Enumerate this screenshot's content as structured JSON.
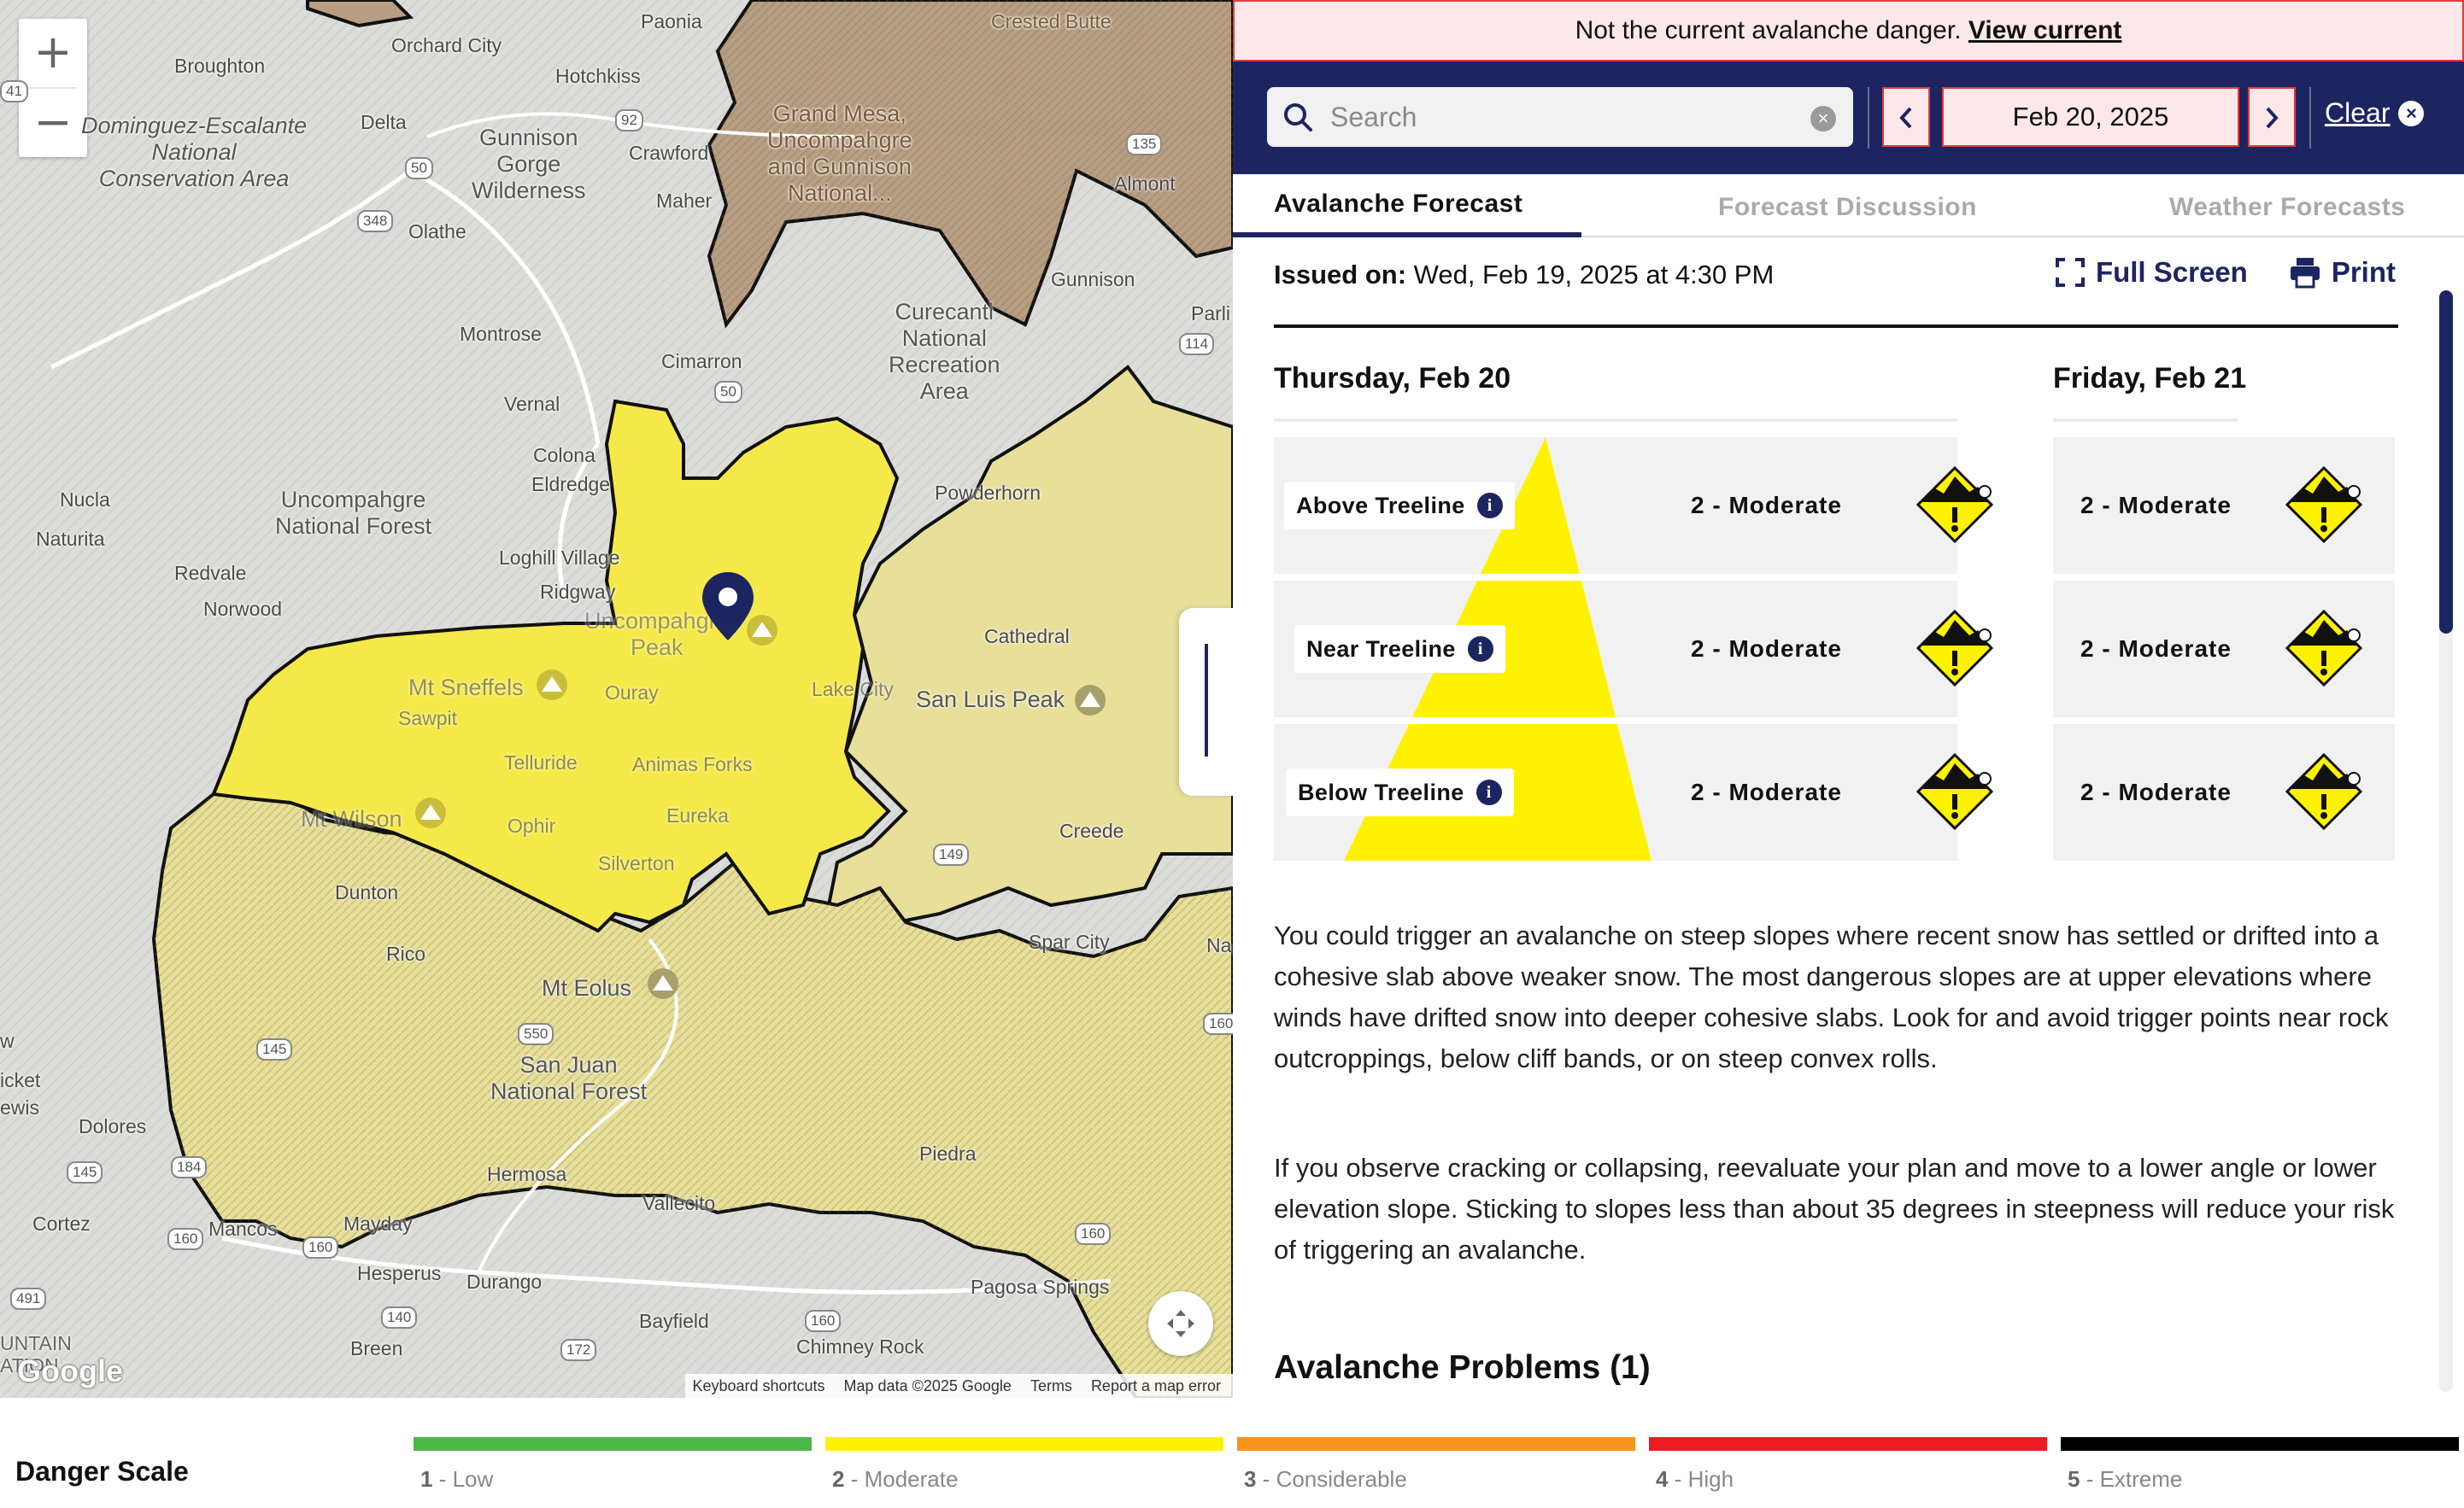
{
  "map": {
    "zoom_in": "+",
    "zoom_out": "−",
    "labels": {
      "paonia": "Paonia",
      "orchard_city": "Orchard City",
      "crested_butte": "Crested Butte",
      "broughton": "Broughton",
      "hotchkiss": "Hotchkiss",
      "dominguez": "Dominguez-Escalante\nNational\nConservation Area",
      "delta": "Delta",
      "gunnison_gorge": "Gunnison\nGorge\nWilderness",
      "crawford": "Crawford",
      "grand_mesa": "Grand Mesa,\nUncompahgre\nand Gunnison\nNational...",
      "almont": "Almont",
      "maher": "Maher",
      "olathe": "Olathe",
      "gunnison": "Gunnison",
      "parli": "Parli",
      "montrose": "Montrose",
      "curecanti": "Curecanti\nNational\nRecreation\nArea",
      "cimarron": "Cimarron",
      "vernal": "Vernal",
      "colona": "Colona",
      "eldredge": "Eldredge",
      "powderhorn": "Powderhorn",
      "nucla": "Nucla",
      "uncompahgre_nf": "Uncompahgre\nNational Forest",
      "naturita": "Naturita",
      "loghill": "Loghill Village",
      "redvale": "Redvale",
      "ridgway": "Ridgway",
      "norwood": "Norwood",
      "uncompahgre_peak": "Uncompahgre\nPeak",
      "cathedral": "Cathedral",
      "mt_sneffels": "Mt Sneffels",
      "ouray": "Ouray",
      "lake_city": "Lake City",
      "san_luis_peak": "San Luis Peak",
      "sawpit": "Sawpit",
      "telluride": "Telluride",
      "animas_forks": "Animas Forks",
      "mt_wilson": "Mt Wilson",
      "ophir": "Ophir",
      "eureka": "Eureka",
      "creede": "Creede",
      "silverton": "Silverton",
      "dunton": "Dunton",
      "spar_city": "Spar City",
      "rico": "Rico",
      "mt_eolus": "Mt Eolus",
      "san_juan_nf": "San Juan\nNational Forest",
      "hermosa": "Hermosa",
      "piedra": "Piedra",
      "dolores": "Dolores",
      "cortez": "Cortez",
      "mancos": "Mancos",
      "mayday": "Mayday",
      "vallecito": "Vallecito",
      "hesperus": "Hesperus",
      "durango": "Durango",
      "pagosa": "Pagosa Springs",
      "bayfield": "Bayfield",
      "breen": "Breen",
      "chimney_rock": "Chimney Rock",
      "cket": "icket",
      "ewis": "ewis",
      "w": "w",
      "mountain": "UNTAIN\nATION",
      "na": "Na"
    },
    "routes": [
      "50",
      "92",
      "348",
      "135",
      "114",
      "50",
      "149",
      "145",
      "550",
      "184",
      "145",
      "160",
      "160",
      "491",
      "140",
      "172",
      "160",
      "160",
      "160",
      "41"
    ],
    "attribution": {
      "shortcuts": "Keyboard shortcuts",
      "data": "Map data ©2025 Google",
      "terms": "Terms",
      "report": "Report a map error"
    },
    "google_logo": "Google"
  },
  "banner": {
    "text": "Not the current avalanche danger.",
    "link": "View current"
  },
  "toolbar": {
    "search_placeholder": "Search",
    "date": "Feb 20, 2025",
    "clear_label": "Clear"
  },
  "tabs": [
    "Avalanche Forecast",
    "Forecast Discussion",
    "Weather Forecasts"
  ],
  "forecast": {
    "issued_label": "Issued on:",
    "issued_value": "Wed, Feb 19, 2025 at 4:30 PM",
    "full_screen": "Full Screen",
    "print": "Print",
    "days": [
      {
        "title": "Thursday, Feb 20",
        "rows": [
          {
            "elevation": "Above Treeline",
            "rating": "2 - Moderate"
          },
          {
            "elevation": "Near Treeline",
            "rating": "2 - Moderate"
          },
          {
            "elevation": "Below Treeline",
            "rating": "2 - Moderate"
          }
        ]
      },
      {
        "title": "Friday, Feb 21",
        "rows": [
          {
            "rating": "2 - Moderate"
          },
          {
            "rating": "2 - Moderate"
          },
          {
            "rating": "2 - Moderate"
          }
        ]
      }
    ],
    "summary_1": "You could trigger an avalanche on steep slopes where recent snow has settled or drifted into a cohesive slab above weaker snow. The most dangerous slopes are at upper elevations where winds have drifted snow into deeper cohesive slabs. Look for and avoid trigger points near rock outcroppings, below cliff bands, or on steep convex rolls.",
    "summary_2": "If you observe cracking or collapsing, reevaluate your plan and move to a lower angle or lower elevation slope. Sticking to slopes less than about 35 degrees in steepness will reduce your risk of triggering an avalanche.",
    "problems_title": "Avalanche Problems",
    "problems_count": "(1)"
  },
  "danger_scale": {
    "title": "Danger Scale",
    "levels": [
      {
        "num": "1",
        "name": " - Low",
        "color": "#4cb848"
      },
      {
        "num": "2",
        "name": " - Moderate",
        "color": "#fff200"
      },
      {
        "num": "3",
        "name": " - Considerable",
        "color": "#f7941e"
      },
      {
        "num": "4",
        "name": " - High",
        "color": "#ed1c24"
      },
      {
        "num": "5",
        "name": " - Extreme",
        "color": "#000000"
      }
    ]
  },
  "colors": {
    "navy": "#1d2561",
    "moderate": "#fff200",
    "alert_red": "#e23b3b"
  }
}
